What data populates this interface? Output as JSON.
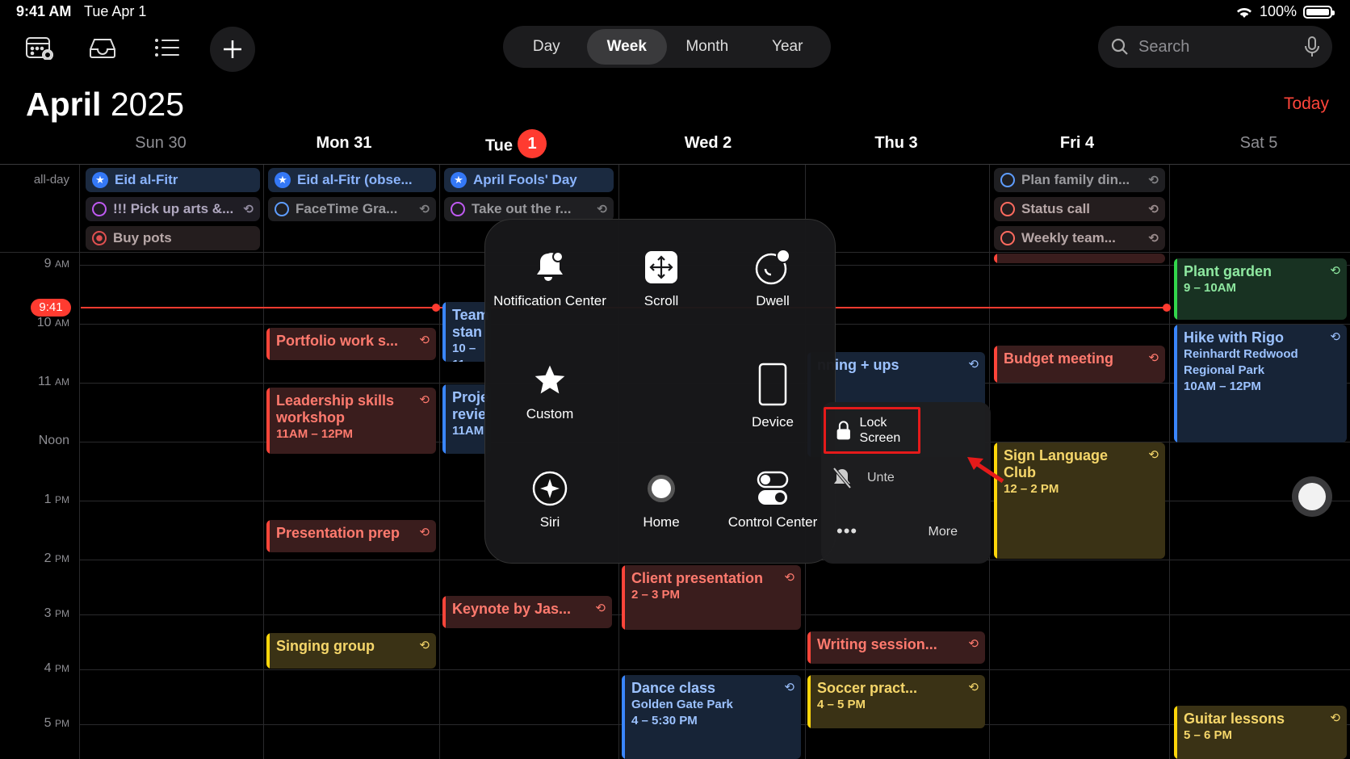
{
  "status": {
    "time": "9:41 AM",
    "date": "Tue Apr 1",
    "battery": "100%"
  },
  "toolbar": {
    "views": [
      "Day",
      "Week",
      "Month",
      "Year"
    ],
    "active_view": "Week",
    "search_placeholder": "Search"
  },
  "header": {
    "month": "April",
    "year": "2025",
    "today_label": "Today"
  },
  "days": [
    {
      "label": "Sun 30"
    },
    {
      "label": "Mon 31"
    },
    {
      "label": "Tue",
      "badge": "1"
    },
    {
      "label": "Wed 2"
    },
    {
      "label": "Thu 3"
    },
    {
      "label": "Fri 4"
    },
    {
      "label": "Sat 5"
    }
  ],
  "allday_label": "all-day",
  "allday": [
    "Eid al-Fitr",
    "!!! Pick up arts &...",
    "Buy pots",
    "Eid al-Fitr (obse...",
    "FaceTime Gra...",
    "April Fools' Day",
    "Take out the r...",
    "Plan family din...",
    "Status call",
    "Weekly team..."
  ],
  "hours": [
    {
      "h": "9",
      "p": "AM"
    },
    {
      "h": "10",
      "p": "AM"
    },
    {
      "h": "11",
      "p": "AM"
    },
    {
      "h": "Noon",
      "p": ""
    },
    {
      "h": "1",
      "p": "PM"
    },
    {
      "h": "2",
      "p": "PM"
    },
    {
      "h": "3",
      "p": "PM"
    },
    {
      "h": "4",
      "p": "PM"
    },
    {
      "h": "5",
      "p": "PM"
    }
  ],
  "now_label": "9:41",
  "events": {
    "portfolio": "Portfolio work s...",
    "leadership_title": "Leadership skills workshop",
    "leadership_time": "11AM – 12PM",
    "presentation_prep": "Presentation prep",
    "singing": "Singing group",
    "team_title": "Team stan",
    "team_time": "10 – 11",
    "project_title": "Proje revie",
    "project_time": "11AM",
    "keynote": "Keynote by Jas...",
    "client_title": "Client presentation",
    "client_time": "2 – 3 PM",
    "dance_title": "Dance class",
    "dance_loc": "Golden Gate Park",
    "dance_time": "4 – 5:30 PM",
    "planning_title": "nning + ups",
    "writing": "Writing session...",
    "soccer_title": "Soccer pract...",
    "soccer_time": "4 – 5 PM",
    "budget": "Budget meeting",
    "sign_title": "Sign Language Club",
    "sign_time": "12 – 2 PM",
    "plant_title": "Plant garden",
    "plant_time": "9 – 10AM",
    "hike_title": "Hike with Rigo",
    "hike_loc": "Reinhardt Redwood Regional Park",
    "hike_time": "10AM – 12PM",
    "guitar_title": "Guitar lessons",
    "guitar_time": "5 – 6 PM"
  },
  "assistive_menu": {
    "notification_center": "Notification Center",
    "scroll": "Scroll",
    "dwell": "Dwell",
    "custom": "Custom",
    "device": "Device",
    "siri": "Siri",
    "home": "Home",
    "control_center": "Control Center"
  },
  "device_submenu": {
    "lock_screen": "Lock Screen",
    "mute": "Unte",
    "more": "More"
  }
}
